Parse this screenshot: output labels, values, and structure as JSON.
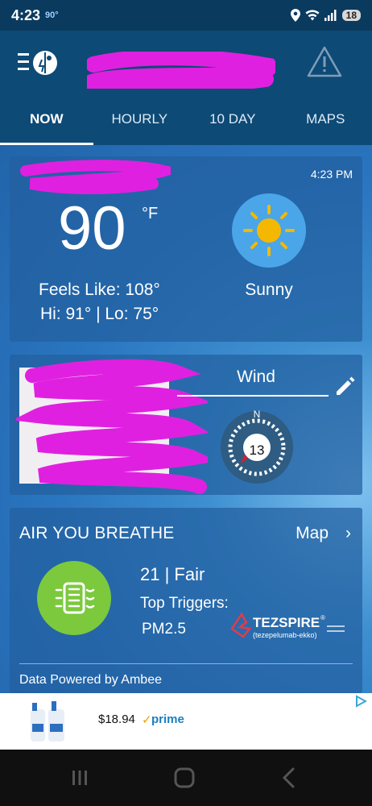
{
  "status_bar": {
    "time": "4:23",
    "temp": "90°",
    "battery": "18"
  },
  "app_bar": {
    "menu_icon": "weather-bug-menu-icon",
    "alert_icon": "warning-triangle-icon"
  },
  "tabs": [
    {
      "label": "NOW",
      "active": true
    },
    {
      "label": "HOURLY",
      "active": false
    },
    {
      "label": "10 DAY",
      "active": false
    },
    {
      "label": "MAPS",
      "active": false
    }
  ],
  "now_card": {
    "updated_time": "4:23 PM",
    "temperature": "90",
    "unit": "°F",
    "feels_like": "Feels Like: 108°",
    "hi_lo": "Hi: 91° | Lo: 75°",
    "condition": "Sunny",
    "condition_icon": "sun-icon"
  },
  "wind_card": {
    "title": "Wind",
    "speed": "13",
    "compass_north": "N"
  },
  "air_card": {
    "title": "AIR YOU BREATHE",
    "map_link": "Map",
    "aqi": "21 | Fair",
    "top_triggers_label": "Top Triggers:",
    "top_trigger": "PM2.5",
    "sponsor_name": "TEZSPIRE",
    "sponsor_registered": "®",
    "sponsor_generic": "(tezepelumab-ekko)",
    "powered_by": "Data Powered by Ambee"
  },
  "ad_banner": {
    "price": "$18.94",
    "prime": "prime",
    "prime_check": "✓"
  },
  "colors": {
    "app_bar": "#0d4a76",
    "aqi_good": "#7cc93d",
    "sun": "#f5b800"
  }
}
